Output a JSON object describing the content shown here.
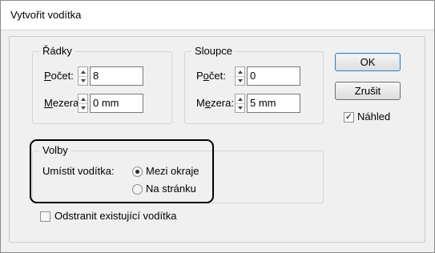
{
  "window": {
    "title": "Vytvořit vodítka"
  },
  "rows_group": {
    "title": "Řádky",
    "count_label_accel": "P",
    "count_label_rest": "očet:",
    "count_value": "8",
    "gap_label_accel": "M",
    "gap_label_rest": "ezera:",
    "gap_value": "0 mm"
  },
  "columns_group": {
    "title": "Sloupce",
    "count_label_pre": "P",
    "count_label_accel": "o",
    "count_label_rest": "čet:",
    "count_value": "0",
    "gap_label_pre": "M",
    "gap_label_accel": "e",
    "gap_label_rest": "zera:",
    "gap_value": "5 mm"
  },
  "options_group": {
    "title": "Volby",
    "place_label": "Umístit vodítka:",
    "radio_margins": "Mezi okraje",
    "radio_page": "Na stránku",
    "remove_existing": "Odstranit existující vodítka"
  },
  "buttons": {
    "ok": "OK",
    "cancel": "Zrušit",
    "preview": "Náhled"
  }
}
